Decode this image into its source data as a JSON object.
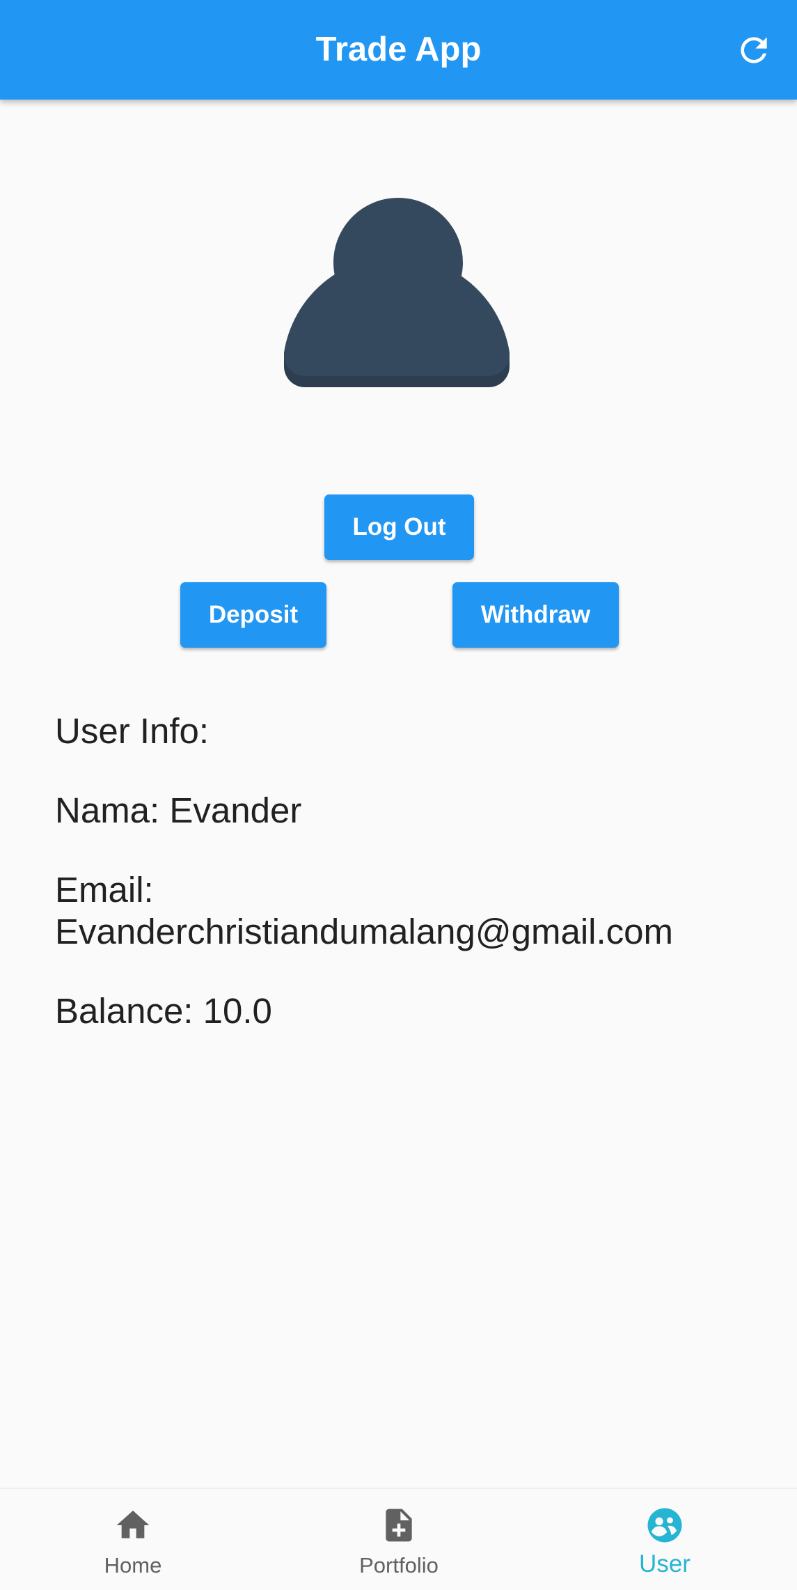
{
  "appbar": {
    "title": "Trade App",
    "refresh_icon": "refresh-icon"
  },
  "profile": {
    "avatar_icon": "person-icon"
  },
  "actions": {
    "logout": "Log Out",
    "deposit": "Deposit",
    "withdraw": "Withdraw"
  },
  "user_info": {
    "heading": "User Info:",
    "name_line": "Nama: Evander",
    "email_label": "Email:",
    "email_value": "Evanderchristiandumalang@gmail.com",
    "balance_line": "Balance: 10.0"
  },
  "bottom_nav": {
    "items": [
      {
        "label": "Home",
        "icon": "home-icon"
      },
      {
        "label": "Portfolio",
        "icon": "document-add-icon"
      },
      {
        "label": "User",
        "icon": "user-group-icon",
        "active": true
      }
    ]
  },
  "colors": {
    "primary": "#2196f3",
    "active_nav": "#26b4d3",
    "avatar": "#34495e"
  }
}
